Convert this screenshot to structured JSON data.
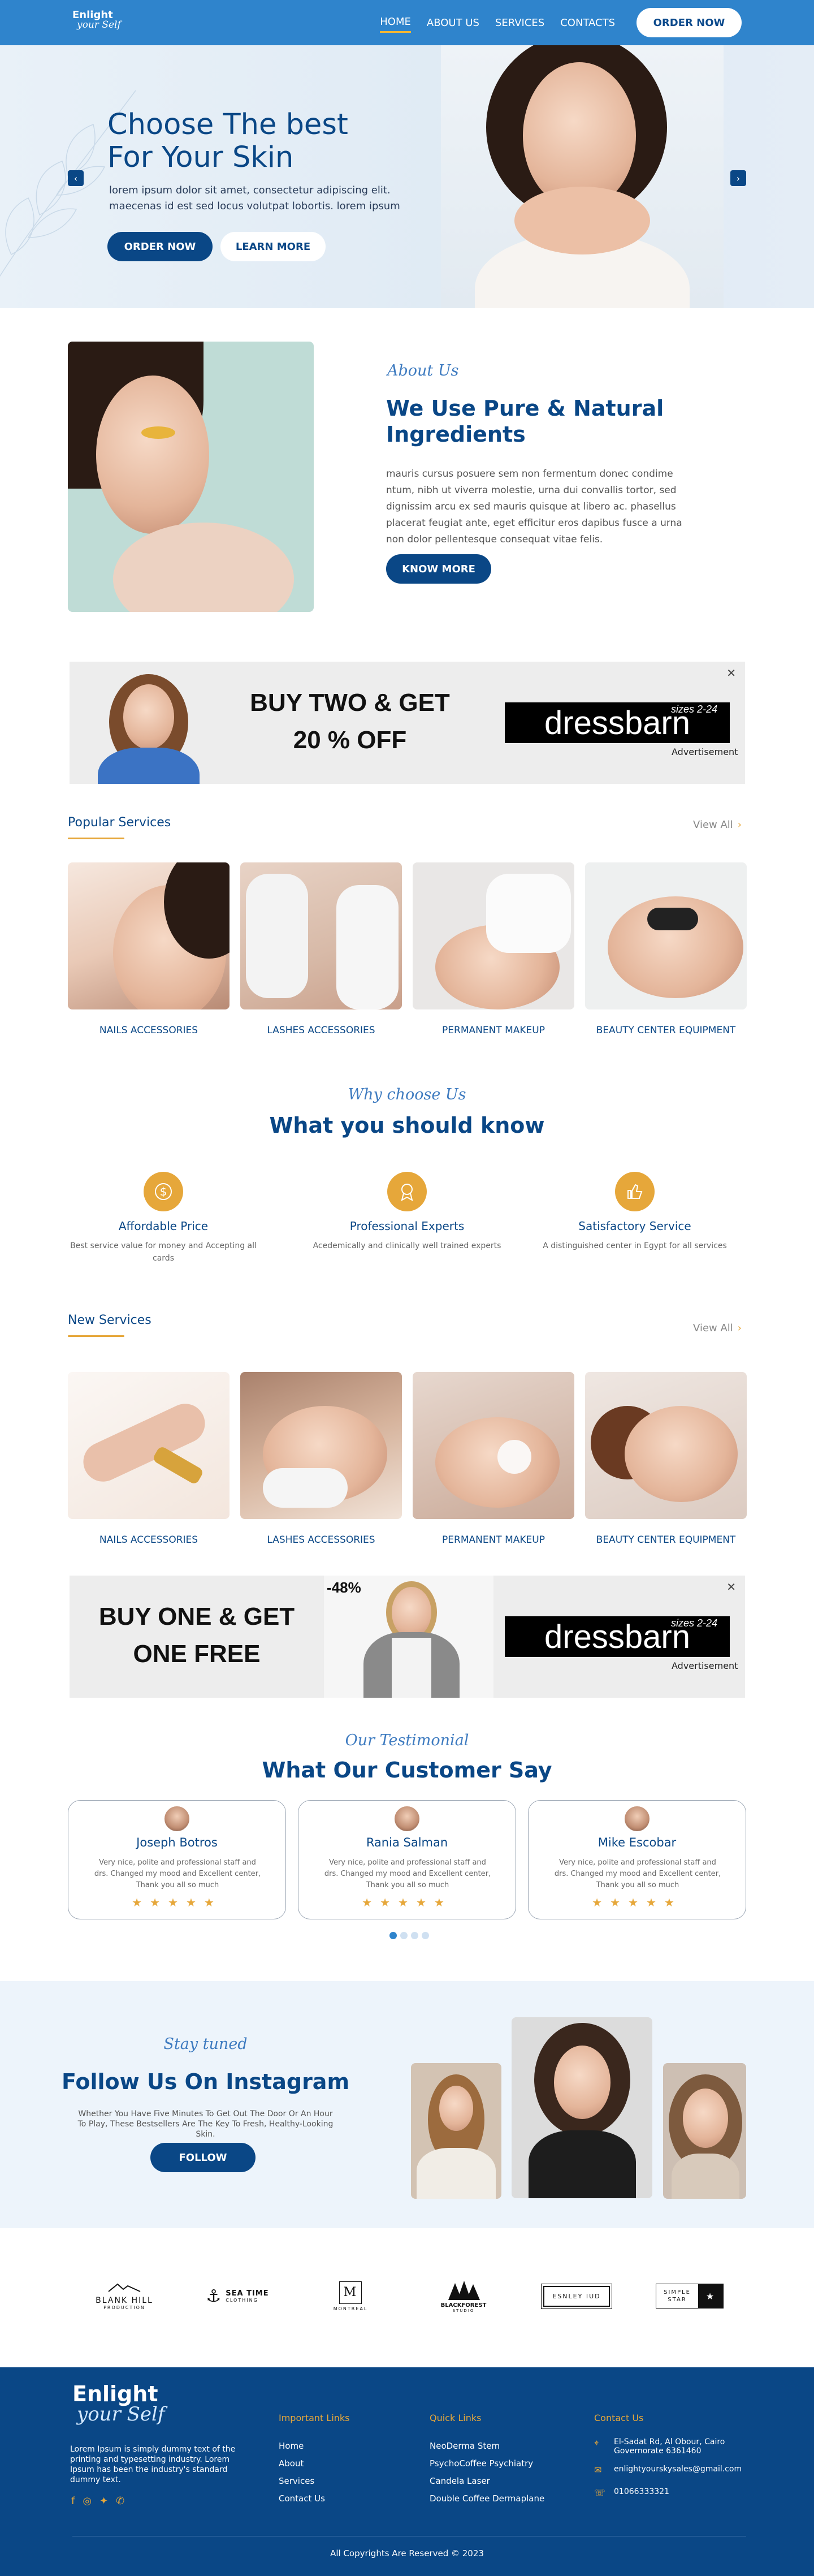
{
  "header": {
    "logo_line1": "Enlight",
    "logo_line2": "your Self",
    "nav": [
      "HOME",
      "ABOUT US",
      "SERVICES",
      "CONTACTS"
    ],
    "order_button": "ORDER NOW"
  },
  "hero": {
    "title_line1": "Choose The best",
    "title_line2": "For Your Skin",
    "description": "lorem ipsum dolor sit amet, consectetur adipiscing elit. maecenas id est sed locus volutpat lobortis. lorem ipsum",
    "order_button": "ORDER NOW",
    "learn_button": "LEARN MORE",
    "prev_arrow": "‹",
    "next_arrow": "›"
  },
  "about": {
    "script_label": "About Us",
    "title": "We Use Pure & Natural Ingredients",
    "text": "mauris cursus posuere sem non fermentum donec condime ntum, nibh ut viverra molestie, urna dui convallis tortor, sed dignissim arcu ex sed mauris quisque at libero ac. phasellus placerat feugiat ante, eget efficitur eros dapibus fusce a urna non dolor pellentesque consequat vitae felis.",
    "button": "KNOW MORE"
  },
  "ad1": {
    "text_line1": "BUY TWO & GET",
    "text_line2": "20 % OFF",
    "brand": "dressbarn",
    "size_tag": "sizes 2-24",
    "label": "Advertisement",
    "close": "✕"
  },
  "popular": {
    "heading": "Popular Services",
    "view_all": "View All",
    "items": [
      "NAILS ACCESSORIES",
      "LASHES ACCESSORIES",
      "PERMANENT MAKEUP",
      "BEAUTY CENTER EQUIPMENT"
    ]
  },
  "why": {
    "script_label": "Why choose Us",
    "title": "What you should know",
    "items": [
      {
        "title": "Affordable Price",
        "text": "Best service value for money and Accepting all cards",
        "icon": "dollar-icon"
      },
      {
        "title": "Professional Experts",
        "text": "Acedemically and clinically well trained experts",
        "icon": "award-icon"
      },
      {
        "title": "Satisfactory Service",
        "text": "A distinguished center in Egypt for all services",
        "icon": "thumbs-up-icon"
      }
    ]
  },
  "new_services": {
    "heading": "New Services",
    "view_all": "View All",
    "items": [
      "NAILS ACCESSORIES",
      "LASHES ACCESSORIES",
      "PERMANENT MAKEUP",
      "BEAUTY CENTER EQUIPMENT"
    ]
  },
  "ad2": {
    "text_line1": "BUY ONE & GET",
    "text_line2": "ONE FREE",
    "discount": "-48%",
    "brand": "dressbarn",
    "size_tag": "sizes 2-24",
    "label": "Advertisement",
    "close": "✕"
  },
  "testimonials": {
    "script_label": "Our Testimonial",
    "title": "What Our Customer Say",
    "items": [
      {
        "name": "Joseph Botros",
        "quote": "Very nice, polite and professional staff and drs. Changed my mood and Excellent center, Thank you all so much",
        "stars": "★★★★★"
      },
      {
        "name": "Rania Salman",
        "quote": "Very nice, polite and professional staff and drs. Changed my mood and Excellent center, Thank you all so much",
        "stars": "★★★★★"
      },
      {
        "name": "Mike Escobar",
        "quote": "Very nice, polite and professional staff and drs. Changed my mood and Excellent center, Thank you all so much",
        "stars": "★★★★★"
      }
    ]
  },
  "instagram": {
    "script_label": "Stay tuned",
    "title": "Follow Us On Instagram",
    "description": "Whether You Have Five Minutes To Get Out The Door Or An Hour To Play, These Bestsellers Are The Key To Fresh, Healthy-Looking Skin.",
    "button": "FOLLOW"
  },
  "brands": [
    {
      "name": "BLANK HILL",
      "sub": "PRODUCTION"
    },
    {
      "name": "SEA TIME",
      "sub": "CLOTHING"
    },
    {
      "name": "M",
      "sub": "MONTREAL"
    },
    {
      "name": "BLACKFOREST",
      "sub": "STUDIO"
    },
    {
      "name": "ESNLEY IUD",
      "sub": ""
    },
    {
      "name": "SIMPLE STAR",
      "sub": "★"
    }
  ],
  "footer": {
    "logo_line1": "Enlight",
    "logo_line2": "your Self",
    "description": "Lorem Ipsum is simply dummy text of the printing and typesetting industry. Lorem Ipsum has been the industry's standard dummy text.",
    "important_heading": "Important Links",
    "important_links": [
      "Home",
      "About",
      "Services",
      "Contact Us"
    ],
    "quick_heading": "Quick Links",
    "quick_links": [
      "NeoDerma Stem",
      "PsychoCoffee Psychiatry",
      "Candela Laser",
      "Double Coffee Dermaplane"
    ],
    "contact_heading": "Contact Us",
    "address": "El-Sadat Rd, Al Obour, Cairo Governorate 6361460",
    "email": "enlightyourskysales@gmail.com",
    "phone": "01066333321",
    "copyright": "All Copyrights Are Reserved © 2023"
  },
  "colors": {
    "primary": "#0a4786",
    "header_blue": "#2f84cc",
    "accent": "#e6a73a"
  }
}
